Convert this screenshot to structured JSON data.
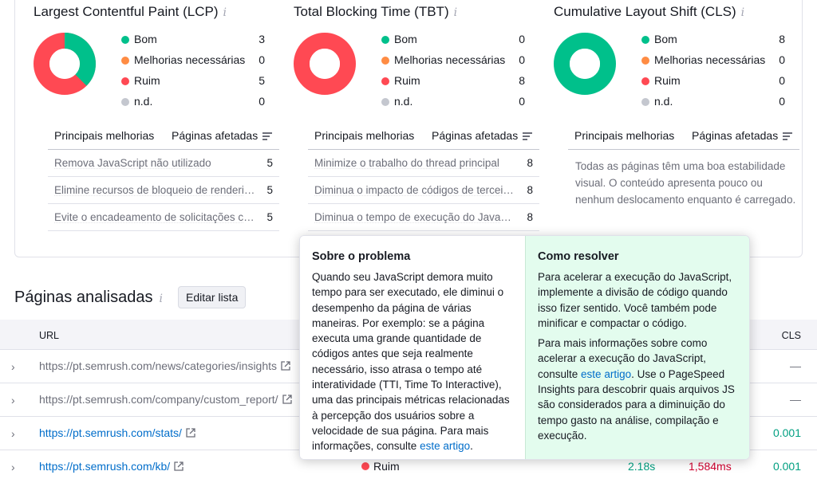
{
  "metrics": [
    {
      "title": "Largest Contentful Paint (LCP)",
      "legend": [
        {
          "label": "Bom",
          "value": "3",
          "color": "#00c08b"
        },
        {
          "label": "Melhorias necessárias",
          "value": "0",
          "color": "#ff8c43"
        },
        {
          "label": "Ruim",
          "value": "5",
          "color": "#ff4953"
        },
        {
          "label": "n.d.",
          "value": "0",
          "color": "#c4c7cf"
        }
      ],
      "table_headers": [
        "Principais melhorias",
        "Páginas afetadas"
      ],
      "rows": [
        {
          "name": "Remova JavaScript não utilizado",
          "count": "5"
        },
        {
          "name": "Elimine recursos de bloqueio de renderização",
          "count": "5"
        },
        {
          "name": "Evite o encadeamento de solicitações críticas",
          "count": "5"
        }
      ]
    },
    {
      "title": "Total Blocking Time (TBT)",
      "legend": [
        {
          "label": "Bom",
          "value": "0",
          "color": "#00c08b"
        },
        {
          "label": "Melhorias necessárias",
          "value": "0",
          "color": "#ff8c43"
        },
        {
          "label": "Ruim",
          "value": "8",
          "color": "#ff4953"
        },
        {
          "label": "n.d.",
          "value": "0",
          "color": "#c4c7cf"
        }
      ],
      "table_headers": [
        "Principais melhorias",
        "Páginas afetadas"
      ],
      "rows": [
        {
          "name": "Minimize o trabalho do thread principal",
          "count": "8"
        },
        {
          "name": "Diminua o impacto de códigos de terceiros",
          "count": "8"
        },
        {
          "name": "Diminua o tempo de execução do JavaScript",
          "count": "8"
        }
      ]
    },
    {
      "title": "Cumulative Layout Shift (CLS)",
      "legend": [
        {
          "label": "Bom",
          "value": "8",
          "color": "#00c08b"
        },
        {
          "label": "Melhorias necessárias",
          "value": "0",
          "color": "#ff8c43"
        },
        {
          "label": "Ruim",
          "value": "0",
          "color": "#ff4953"
        },
        {
          "label": "n.d.",
          "value": "0",
          "color": "#c4c7cf"
        }
      ],
      "table_headers": [
        "Principais melhorias",
        "Páginas afetadas"
      ],
      "note": "Todas as páginas têm uma boa estabilidade visual. O conteúdo apresenta pouco ou nenhum deslocamento enquanto é carregado."
    }
  ],
  "pages": {
    "title": "Páginas analisadas",
    "edit_label": "Editar lista",
    "col_url": "URL",
    "col_cls": "CLS",
    "rows": [
      {
        "url": "https://pt.semrush.com/news/categories/insights",
        "cls": "—"
      },
      {
        "url": "https://pt.semrush.com/company/custom_report/",
        "cls": "—"
      },
      {
        "url": "https://pt.semrush.com/stats/",
        "cls": "0.001"
      },
      {
        "url": "https://pt.semrush.com/kb/",
        "status": "Ruim",
        "lcp": "2.18s",
        "tbt": "1,584ms",
        "cls": "0.001"
      }
    ]
  },
  "tooltip": {
    "problem_title": "Sobre o problema",
    "problem_text": "Quando seu JavaScript demora muito tempo para ser executado, ele diminui o desempenho da página de várias maneiras. Por exemplo: se a página executa uma grande quantidade de códigos antes que seja realmente necessário, isso atrasa o tempo até interatividade (TTI, Time To Interactive), uma das principais métricas relacionadas à percepção dos usuários sobre a velocidade de sua página. Para mais informações, consulte ",
    "problem_link": "este artigo",
    "problem_end": ".",
    "fix_title": "Como resolver",
    "fix_text1": "Para acelerar a execução do JavaScript, implemente a divisão de código quando isso fizer sentido. Você também pode minificar e compactar o código.",
    "fix_text2_a": "Para mais informações sobre como acelerar a execução do JavaScript, consulte ",
    "fix_link": "este artigo",
    "fix_text2_b": ". Use o PageSpeed Insights para descobrir quais arquivos JS são considerados para a diminuição do tempo gasto na análise, compilação e execução."
  }
}
